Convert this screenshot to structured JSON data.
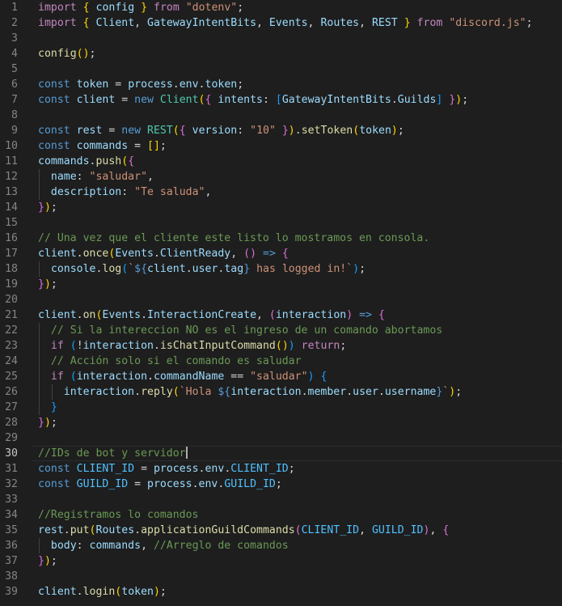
{
  "editor": {
    "current_line": 30,
    "lines": [
      {
        "n": "1",
        "tokens": [
          [
            "import",
            "kw"
          ],
          [
            " ",
            "pun"
          ],
          [
            "{",
            "b1"
          ],
          [
            " ",
            "pun"
          ],
          [
            "config",
            "var"
          ],
          [
            " ",
            "pun"
          ],
          [
            "}",
            "b1"
          ],
          [
            " ",
            "pun"
          ],
          [
            "from",
            "kw"
          ],
          [
            " ",
            "pun"
          ],
          [
            "\"dotenv\"",
            "str"
          ],
          [
            ";",
            "pun"
          ]
        ]
      },
      {
        "n": "2",
        "tokens": [
          [
            "import",
            "kw"
          ],
          [
            " ",
            "pun"
          ],
          [
            "{",
            "b1"
          ],
          [
            " ",
            "pun"
          ],
          [
            "Client",
            "var"
          ],
          [
            ", ",
            "pun"
          ],
          [
            "GatewayIntentBits",
            "var"
          ],
          [
            ", ",
            "pun"
          ],
          [
            "Events",
            "var"
          ],
          [
            ", ",
            "pun"
          ],
          [
            "Routes",
            "var"
          ],
          [
            ", ",
            "pun"
          ],
          [
            "REST",
            "var"
          ],
          [
            " ",
            "pun"
          ],
          [
            "}",
            "b1"
          ],
          [
            " ",
            "pun"
          ],
          [
            "from",
            "kw"
          ],
          [
            " ",
            "pun"
          ],
          [
            "\"discord.js\"",
            "str"
          ],
          [
            ";",
            "pun"
          ]
        ]
      },
      {
        "n": "3",
        "tokens": []
      },
      {
        "n": "4",
        "tokens": [
          [
            "config",
            "fn"
          ],
          [
            "(",
            "b1"
          ],
          [
            ")",
            "b1"
          ],
          [
            ";",
            "pun"
          ]
        ]
      },
      {
        "n": "5",
        "tokens": []
      },
      {
        "n": "6",
        "tokens": [
          [
            "const",
            "st"
          ],
          [
            " ",
            "pun"
          ],
          [
            "token",
            "var"
          ],
          [
            " = ",
            "pun"
          ],
          [
            "process",
            "var"
          ],
          [
            ".",
            "pun"
          ],
          [
            "env",
            "var"
          ],
          [
            ".",
            "pun"
          ],
          [
            "token",
            "var"
          ],
          [
            ";",
            "pun"
          ]
        ]
      },
      {
        "n": "7",
        "tokens": [
          [
            "const",
            "st"
          ],
          [
            " ",
            "pun"
          ],
          [
            "client",
            "var"
          ],
          [
            " = ",
            "pun"
          ],
          [
            "new",
            "st"
          ],
          [
            " ",
            "pun"
          ],
          [
            "Client",
            "cls"
          ],
          [
            "(",
            "b1"
          ],
          [
            "{",
            "b2"
          ],
          [
            " ",
            "pun"
          ],
          [
            "intents",
            "var"
          ],
          [
            ": ",
            "pun"
          ],
          [
            "[",
            "b3"
          ],
          [
            "GatewayIntentBits",
            "var"
          ],
          [
            ".",
            "pun"
          ],
          [
            "Guilds",
            "var"
          ],
          [
            "]",
            "b3"
          ],
          [
            " ",
            "pun"
          ],
          [
            "}",
            "b2"
          ],
          [
            ")",
            "b1"
          ],
          [
            ";",
            "pun"
          ]
        ]
      },
      {
        "n": "8",
        "tokens": []
      },
      {
        "n": "9",
        "tokens": [
          [
            "const",
            "st"
          ],
          [
            " ",
            "pun"
          ],
          [
            "rest",
            "var"
          ],
          [
            " = ",
            "pun"
          ],
          [
            "new",
            "st"
          ],
          [
            " ",
            "pun"
          ],
          [
            "REST",
            "cls"
          ],
          [
            "(",
            "b1"
          ],
          [
            "{",
            "b2"
          ],
          [
            " ",
            "pun"
          ],
          [
            "version",
            "var"
          ],
          [
            ": ",
            "pun"
          ],
          [
            "\"10\"",
            "str"
          ],
          [
            " ",
            "pun"
          ],
          [
            "}",
            "b2"
          ],
          [
            ")",
            "b1"
          ],
          [
            ".",
            "pun"
          ],
          [
            "setToken",
            "fn"
          ],
          [
            "(",
            "b1"
          ],
          [
            "token",
            "var"
          ],
          [
            ")",
            "b1"
          ],
          [
            ";",
            "pun"
          ]
        ]
      },
      {
        "n": "10",
        "tokens": [
          [
            "const",
            "st"
          ],
          [
            " ",
            "pun"
          ],
          [
            "commands",
            "var"
          ],
          [
            " = ",
            "pun"
          ],
          [
            "[",
            "b1"
          ],
          [
            "]",
            "b1"
          ],
          [
            ";",
            "pun"
          ]
        ]
      },
      {
        "n": "11",
        "tokens": [
          [
            "commands",
            "var"
          ],
          [
            ".",
            "pun"
          ],
          [
            "push",
            "fn"
          ],
          [
            "(",
            "b1"
          ],
          [
            "{",
            "b2"
          ]
        ]
      },
      {
        "n": "12",
        "guides": [
          1
        ],
        "tokens": [
          [
            "  ",
            "pun"
          ],
          [
            "name",
            "var"
          ],
          [
            ": ",
            "pun"
          ],
          [
            "\"saludar\"",
            "str"
          ],
          [
            ",",
            "pun"
          ]
        ]
      },
      {
        "n": "13",
        "guides": [
          1
        ],
        "tokens": [
          [
            "  ",
            "pun"
          ],
          [
            "description",
            "var"
          ],
          [
            ": ",
            "pun"
          ],
          [
            "\"Te saluda\"",
            "str"
          ],
          [
            ",",
            "pun"
          ]
        ]
      },
      {
        "n": "14",
        "tokens": [
          [
            "}",
            "b2"
          ],
          [
            ")",
            "b1"
          ],
          [
            ";",
            "pun"
          ]
        ]
      },
      {
        "n": "15",
        "tokens": []
      },
      {
        "n": "16",
        "tokens": [
          [
            "// Una vez que el cliente este listo lo mostramos en consola.",
            "cm"
          ]
        ]
      },
      {
        "n": "17",
        "tokens": [
          [
            "client",
            "var"
          ],
          [
            ".",
            "pun"
          ],
          [
            "once",
            "fn"
          ],
          [
            "(",
            "b1"
          ],
          [
            "Events",
            "var"
          ],
          [
            ".",
            "pun"
          ],
          [
            "ClientReady",
            "var"
          ],
          [
            ", ",
            "pun"
          ],
          [
            "(",
            "b2"
          ],
          [
            ")",
            "b2"
          ],
          [
            " ",
            "pun"
          ],
          [
            "=>",
            "st"
          ],
          [
            " ",
            "pun"
          ],
          [
            "{",
            "b2"
          ]
        ]
      },
      {
        "n": "18",
        "guides": [
          1
        ],
        "tokens": [
          [
            "  ",
            "pun"
          ],
          [
            "console",
            "var"
          ],
          [
            ".",
            "pun"
          ],
          [
            "log",
            "fn"
          ],
          [
            "(",
            "b3"
          ],
          [
            "`",
            "str"
          ],
          [
            "${",
            "st"
          ],
          [
            "client",
            "var"
          ],
          [
            ".",
            "pun"
          ],
          [
            "user",
            "var"
          ],
          [
            ".",
            "pun"
          ],
          [
            "tag",
            "var"
          ],
          [
            "}",
            "st"
          ],
          [
            " has logged in!`",
            "str"
          ],
          [
            ")",
            "b3"
          ],
          [
            ";",
            "pun"
          ]
        ]
      },
      {
        "n": "19",
        "tokens": [
          [
            "}",
            "b2"
          ],
          [
            ")",
            "b1"
          ],
          [
            ";",
            "pun"
          ]
        ]
      },
      {
        "n": "20",
        "tokens": []
      },
      {
        "n": "21",
        "tokens": [
          [
            "client",
            "var"
          ],
          [
            ".",
            "pun"
          ],
          [
            "on",
            "fn"
          ],
          [
            "(",
            "b1"
          ],
          [
            "Events",
            "var"
          ],
          [
            ".",
            "pun"
          ],
          [
            "InteractionCreate",
            "var"
          ],
          [
            ", ",
            "pun"
          ],
          [
            "(",
            "b2"
          ],
          [
            "interaction",
            "var"
          ],
          [
            ")",
            "b2"
          ],
          [
            " ",
            "pun"
          ],
          [
            "=>",
            "st"
          ],
          [
            " ",
            "pun"
          ],
          [
            "{",
            "b2"
          ]
        ]
      },
      {
        "n": "22",
        "guides": [
          1
        ],
        "tokens": [
          [
            "  ",
            "pun"
          ],
          [
            "// Si la intereccion NO es el ingreso de un comando abortamos",
            "cm"
          ]
        ]
      },
      {
        "n": "23",
        "guides": [
          1
        ],
        "tokens": [
          [
            "  ",
            "pun"
          ],
          [
            "if",
            "kw"
          ],
          [
            " ",
            "pun"
          ],
          [
            "(",
            "b3"
          ],
          [
            "!",
            "pun"
          ],
          [
            "interaction",
            "var"
          ],
          [
            ".",
            "pun"
          ],
          [
            "isChatInputCommand",
            "fn"
          ],
          [
            "(",
            "b1"
          ],
          [
            ")",
            "b1"
          ],
          [
            ")",
            "b3"
          ],
          [
            " ",
            "pun"
          ],
          [
            "return",
            "kw"
          ],
          [
            ";",
            "pun"
          ]
        ]
      },
      {
        "n": "24",
        "guides": [
          1
        ],
        "tokens": [
          [
            "  ",
            "pun"
          ],
          [
            "// Acción solo si el comando es saludar",
            "cm"
          ]
        ]
      },
      {
        "n": "25",
        "guides": [
          1
        ],
        "tokens": [
          [
            "  ",
            "pun"
          ],
          [
            "if",
            "kw"
          ],
          [
            " ",
            "pun"
          ],
          [
            "(",
            "b3"
          ],
          [
            "interaction",
            "var"
          ],
          [
            ".",
            "pun"
          ],
          [
            "commandName",
            "var"
          ],
          [
            " == ",
            "pun"
          ],
          [
            "\"saludar\"",
            "str"
          ],
          [
            ")",
            "b3"
          ],
          [
            " ",
            "pun"
          ],
          [
            "{",
            "b3"
          ]
        ]
      },
      {
        "n": "26",
        "guides": [
          1,
          2
        ],
        "tokens": [
          [
            "    ",
            "pun"
          ],
          [
            "interaction",
            "var"
          ],
          [
            ".",
            "pun"
          ],
          [
            "reply",
            "fn"
          ],
          [
            "(",
            "b1"
          ],
          [
            "`Hola ",
            "str"
          ],
          [
            "${",
            "st"
          ],
          [
            "interaction",
            "var"
          ],
          [
            ".",
            "pun"
          ],
          [
            "member",
            "var"
          ],
          [
            ".",
            "pun"
          ],
          [
            "user",
            "var"
          ],
          [
            ".",
            "pun"
          ],
          [
            "username",
            "var"
          ],
          [
            "}",
            "st"
          ],
          [
            "`",
            "str"
          ],
          [
            ")",
            "b1"
          ],
          [
            ";",
            "pun"
          ]
        ]
      },
      {
        "n": "27",
        "guides": [
          1
        ],
        "tokens": [
          [
            "  ",
            "pun"
          ],
          [
            "}",
            "b3"
          ]
        ]
      },
      {
        "n": "28",
        "tokens": [
          [
            "}",
            "b2"
          ],
          [
            ")",
            "b1"
          ],
          [
            ";",
            "pun"
          ]
        ]
      },
      {
        "n": "29",
        "tokens": []
      },
      {
        "n": "30",
        "cursor": true,
        "tokens": [
          [
            "//IDs de bot y servidor",
            "cm"
          ]
        ]
      },
      {
        "n": "31",
        "tokens": [
          [
            "const",
            "st"
          ],
          [
            " ",
            "pun"
          ],
          [
            "CLIENT_ID",
            "const"
          ],
          [
            " = ",
            "pun"
          ],
          [
            "process",
            "var"
          ],
          [
            ".",
            "pun"
          ],
          [
            "env",
            "var"
          ],
          [
            ".",
            "pun"
          ],
          [
            "CLIENT_ID",
            "const"
          ],
          [
            ";",
            "pun"
          ]
        ]
      },
      {
        "n": "32",
        "tokens": [
          [
            "const",
            "st"
          ],
          [
            " ",
            "pun"
          ],
          [
            "GUILD_ID",
            "const"
          ],
          [
            " = ",
            "pun"
          ],
          [
            "process",
            "var"
          ],
          [
            ".",
            "pun"
          ],
          [
            "env",
            "var"
          ],
          [
            ".",
            "pun"
          ],
          [
            "GUILD_ID",
            "const"
          ],
          [
            ";",
            "pun"
          ]
        ]
      },
      {
        "n": "33",
        "tokens": []
      },
      {
        "n": "34",
        "tokens": [
          [
            "//Registramos lo comandos",
            "cm"
          ]
        ]
      },
      {
        "n": "35",
        "tokens": [
          [
            "rest",
            "var"
          ],
          [
            ".",
            "pun"
          ],
          [
            "put",
            "fn"
          ],
          [
            "(",
            "b1"
          ],
          [
            "Routes",
            "var"
          ],
          [
            ".",
            "pun"
          ],
          [
            "applicationGuildCommands",
            "fn"
          ],
          [
            "(",
            "b2"
          ],
          [
            "CLIENT_ID",
            "const"
          ],
          [
            ", ",
            "pun"
          ],
          [
            "GUILD_ID",
            "const"
          ],
          [
            ")",
            "b2"
          ],
          [
            ", ",
            "pun"
          ],
          [
            "{",
            "b2"
          ]
        ]
      },
      {
        "n": "36",
        "guides": [
          1
        ],
        "tokens": [
          [
            "  ",
            "pun"
          ],
          [
            "body",
            "var"
          ],
          [
            ": ",
            "pun"
          ],
          [
            "commands",
            "var"
          ],
          [
            ", ",
            "pun"
          ],
          [
            "//Arreglo de comandos",
            "cm"
          ]
        ]
      },
      {
        "n": "37",
        "tokens": [
          [
            "}",
            "b2"
          ],
          [
            ")",
            "b1"
          ],
          [
            ";",
            "pun"
          ]
        ]
      },
      {
        "n": "38",
        "tokens": []
      },
      {
        "n": "39",
        "tokens": [
          [
            "client",
            "var"
          ],
          [
            ".",
            "pun"
          ],
          [
            "login",
            "fn"
          ],
          [
            "(",
            "b1"
          ],
          [
            "token",
            "var"
          ],
          [
            ")",
            "b1"
          ],
          [
            ";",
            "pun"
          ]
        ]
      }
    ]
  }
}
